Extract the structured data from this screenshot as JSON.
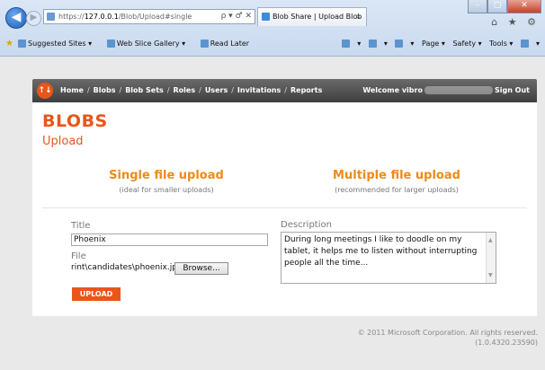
{
  "browser": {
    "url_prefix": "https://",
    "url_host": "127.0.0.1",
    "url_path": "/Blob/Upload#single",
    "address_tools": "ρ ▾ ♂ ✕",
    "tab_title": "Blob Share | Upload Blob",
    "tab_close": "×",
    "window_buttons": [
      "–",
      "▢",
      "✕"
    ],
    "right_icons": "⌂ ★ ⚙",
    "favorites": [
      "Suggested Sites ▾",
      "Web Slice Gallery ▾",
      "Read Later"
    ],
    "toolbar": [
      "▾",
      "▾",
      "▾",
      "Page ▾",
      "Safety ▾",
      "Tools ▾",
      "▾"
    ]
  },
  "site": {
    "logo_text": "↑↓",
    "nav": [
      "Home",
      "Blobs",
      "Blob Sets",
      "Roles",
      "Users",
      "Invitations",
      "Reports"
    ],
    "nav_sep": "/",
    "welcome_label": "Welcome vibro",
    "sign_out": "Sign Out"
  },
  "page": {
    "title": "BLOBS",
    "subtitle": "Upload",
    "single": {
      "title": "Single file upload",
      "note": "(ideal for smaller uploads)"
    },
    "multiple": {
      "title": "Multiple file upload",
      "note": "(recommended for larger uploads)"
    }
  },
  "form": {
    "title_label": "Title",
    "title_value": "Phoenix",
    "file_label": "File",
    "file_value": "rint\\candidates\\phoenix.jpg",
    "browse_label": "Browse...",
    "description_label": "Description",
    "description_value": "During long meetings I like to doodle on my tablet, it helps me to listen without interrupting people all the time...",
    "upload_label": "UPLOAD"
  },
  "footer": {
    "copyright": "© 2011 Microsoft Corporation. All rights reserved.",
    "version": "(1.0.4320.23590)"
  },
  "colors": {
    "accent": "#e8561a",
    "section": "#f08a16",
    "nav_bg": "#4f4f4f"
  }
}
